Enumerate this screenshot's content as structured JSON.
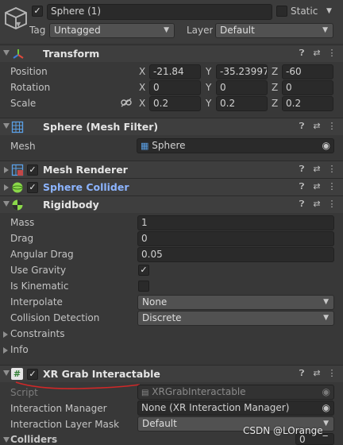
{
  "object": {
    "name": "Sphere (1)",
    "static_label": "Static",
    "tag_label": "Tag",
    "tag_value": "Untagged",
    "layer_label": "Layer",
    "layer_value": "Default"
  },
  "transform": {
    "title": "Transform",
    "position_label": "Position",
    "rotation_label": "Rotation",
    "scale_label": "Scale",
    "axis_x": "X",
    "axis_y": "Y",
    "axis_z": "Z",
    "position": {
      "x": "-21.84",
      "y": "-35.23997",
      "z": "-60"
    },
    "rotation": {
      "x": "0",
      "y": "0",
      "z": "0"
    },
    "scale": {
      "x": "0.2",
      "y": "0.2",
      "z": "0.2"
    }
  },
  "mesh_filter": {
    "title": "Sphere (Mesh Filter)",
    "mesh_label": "Mesh",
    "mesh_value": "Sphere"
  },
  "mesh_renderer": {
    "title": "Mesh Renderer"
  },
  "sphere_collider": {
    "title": "Sphere Collider"
  },
  "rigidbody": {
    "title": "Rigidbody",
    "mass_label": "Mass",
    "mass_value": "1",
    "drag_label": "Drag",
    "drag_value": "0",
    "angular_drag_label": "Angular Drag",
    "angular_drag_value": "0.05",
    "use_gravity_label": "Use Gravity",
    "use_gravity": true,
    "is_kinematic_label": "Is Kinematic",
    "is_kinematic": false,
    "interpolate_label": "Interpolate",
    "interpolate_value": "None",
    "collision_detection_label": "Collision Detection",
    "collision_detection_value": "Discrete",
    "constraints_label": "Constraints",
    "info_label": "Info"
  },
  "xr_grab": {
    "title": "XR Grab Interactable",
    "script_label": "Script",
    "script_value": "XRGrabInteractable",
    "interaction_manager_label": "Interaction Manager",
    "interaction_manager_value": "None (XR Interaction Manager)",
    "layer_mask_label": "Interaction Layer Mask",
    "layer_mask_value": "Default",
    "colliders_label": "Colliders",
    "colliders_value": "0"
  },
  "watermark": "CSDN @LOrange_",
  "icons": {
    "gameobject": "cube-icon",
    "transform": "transform-axes-icon",
    "mesh_filter": "mesh-grid-icon",
    "mesh_renderer": "mesh-renderer-icon",
    "sphere_collider": "sphere-collider-icon",
    "rigidbody": "rigidbody-icon",
    "script": "script-hash-icon",
    "help": "question-circle-icon",
    "presets": "sliders-icon",
    "menu": "kebab-menu-icon",
    "link": "chain-link-icon",
    "target": "object-picker-icon"
  },
  "colors": {
    "background": "#383838",
    "header": "#3e3e3e",
    "field": "#2a2a2a",
    "dropdown": "#515151",
    "collider_title": "#8cb4ff",
    "annotation": "#d02828"
  }
}
